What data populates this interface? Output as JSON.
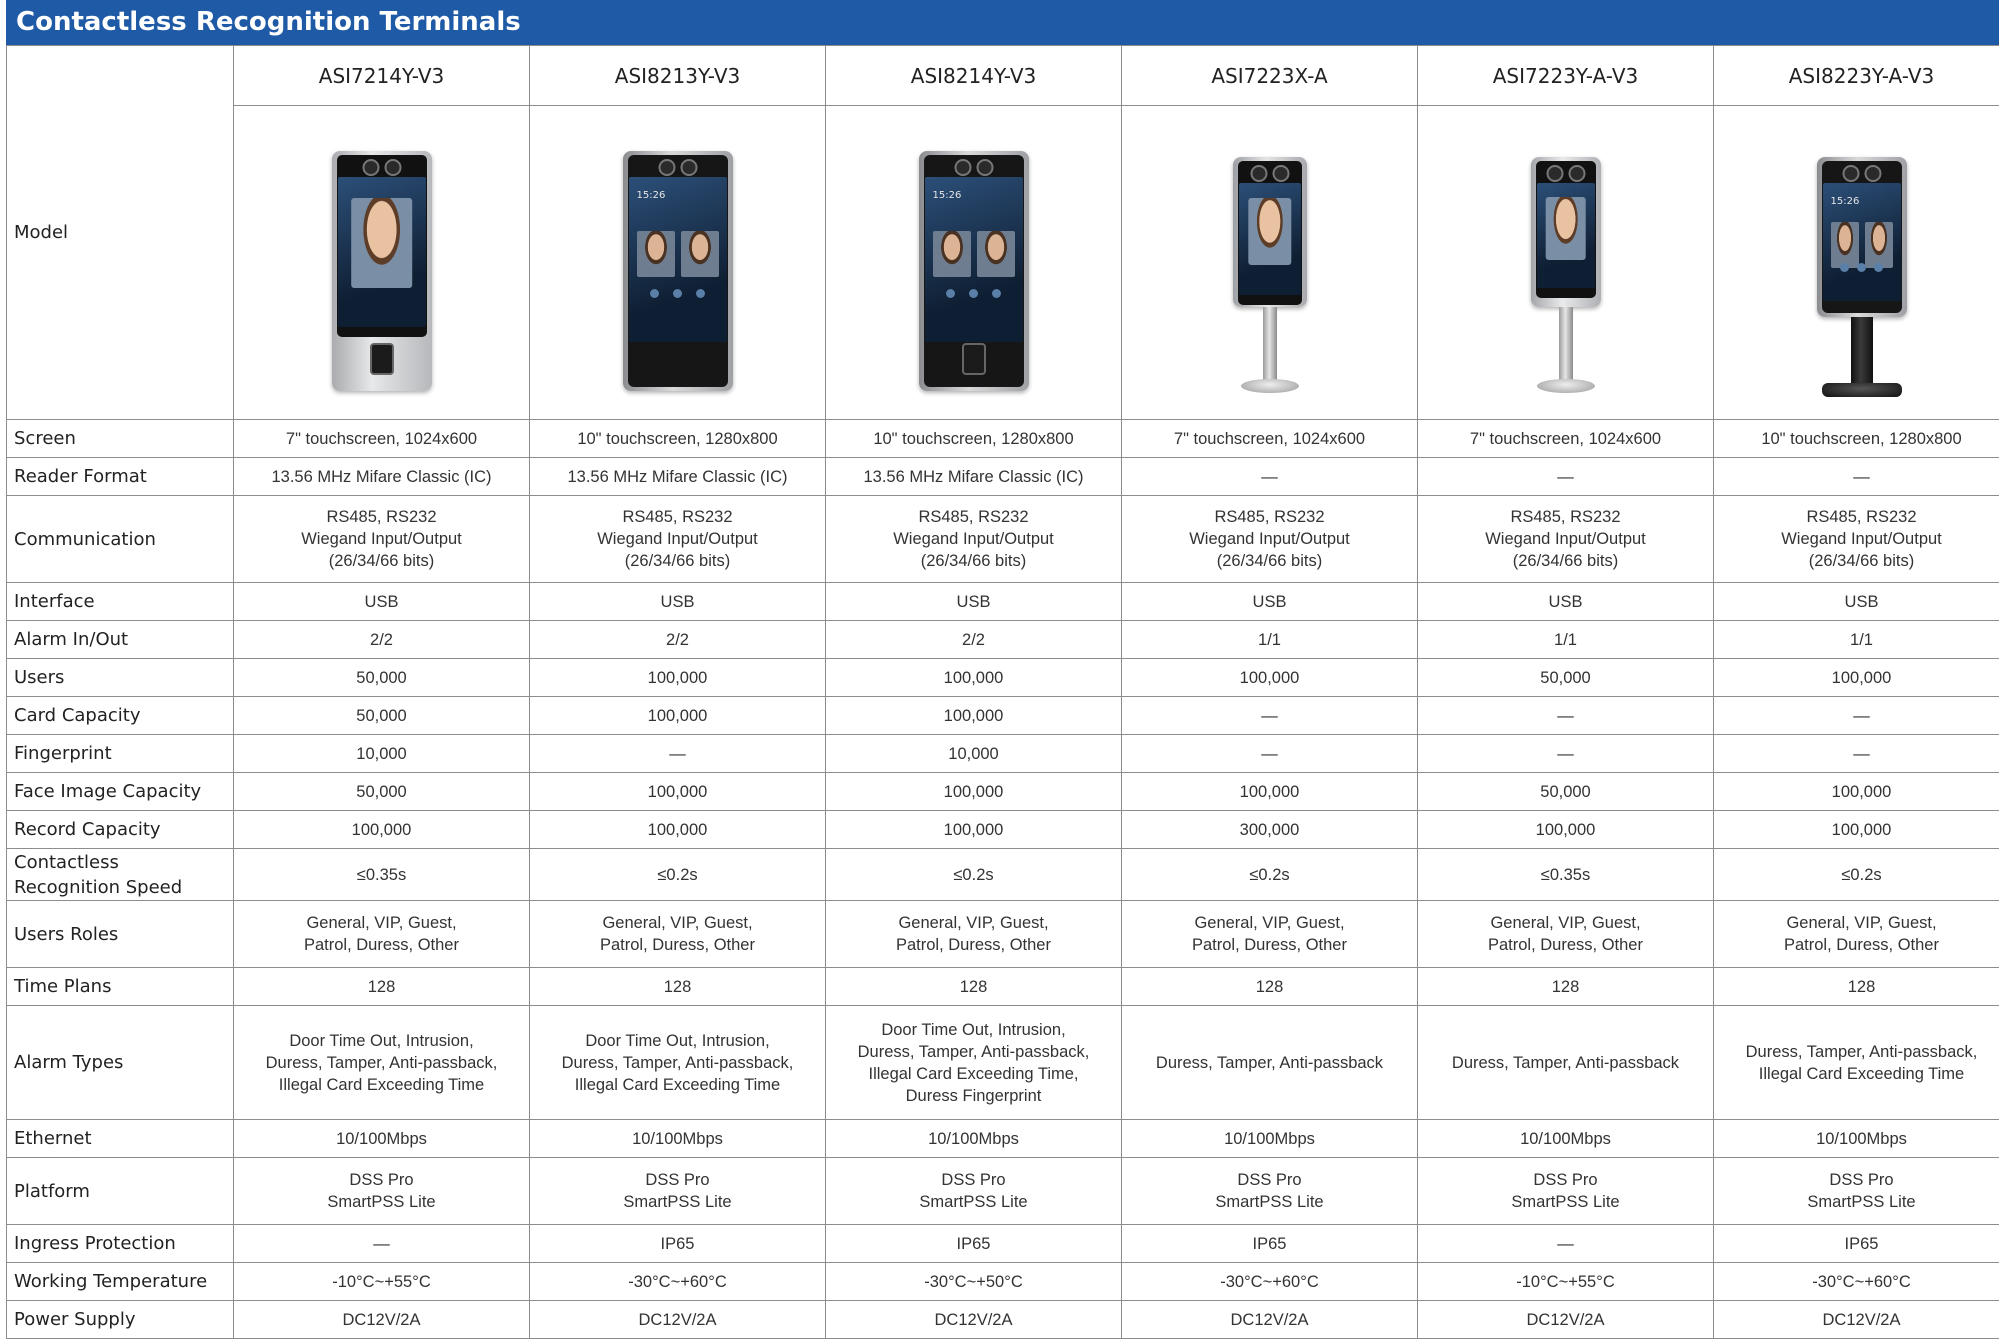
{
  "title": "Contactless Recognition Terminals",
  "model_label": "Model",
  "models": [
    {
      "name": "ASI7214Y-V3",
      "image": "face-terminal-fingerprint-silver"
    },
    {
      "name": "ASI8213Y-V3",
      "image": "face-terminal-black"
    },
    {
      "name": "ASI8214Y-V3",
      "image": "face-terminal-black-fingerprint"
    },
    {
      "name": "ASI7223X-A",
      "image": "face-terminal-on-stand"
    },
    {
      "name": "ASI7223Y-A-V3",
      "image": "face-terminal-silver-on-stand"
    },
    {
      "name": "ASI8223Y-A-V3",
      "image": "face-terminal-black-on-stand"
    }
  ],
  "rows": [
    {
      "label": "Screen",
      "values": [
        "7\" touchscreen, 1024x600",
        "10\" touchscreen, 1280x800",
        "10\" touchscreen, 1280x800",
        "7\" touchscreen, 1024x600",
        "7\" touchscreen, 1024x600",
        "10\" touchscreen, 1280x800"
      ]
    },
    {
      "label": "Reader Format",
      "values": [
        "13.56 MHz Mifare Classic (IC)",
        "13.56 MHz Mifare Classic (IC)",
        "13.56 MHz Mifare Classic (IC)",
        "—",
        "—",
        "—"
      ]
    },
    {
      "label": "Communication",
      "values": [
        "RS485, RS232\nWiegand Input/Output\n(26/34/66 bits)",
        "RS485, RS232\nWiegand Input/Output\n(26/34/66 bits)",
        "RS485, RS232\nWiegand Input/Output\n(26/34/66 bits)",
        "RS485, RS232\nWiegand Input/Output\n(26/34/66 bits)",
        "RS485, RS232\nWiegand Input/Output\n(26/34/66 bits)",
        "RS485, RS232\nWiegand Input/Output\n(26/34/66 bits)"
      ]
    },
    {
      "label": "Interface",
      "values": [
        "USB",
        "USB",
        "USB",
        "USB",
        "USB",
        "USB"
      ]
    },
    {
      "label": "Alarm In/Out",
      "values": [
        "2/2",
        "2/2",
        "2/2",
        "1/1",
        "1/1",
        "1/1"
      ]
    },
    {
      "label": "Users",
      "values": [
        "50,000",
        "100,000",
        "100,000",
        "100,000",
        "50,000",
        "100,000"
      ]
    },
    {
      "label": "Card Capacity",
      "values": [
        "50,000",
        "100,000",
        "100,000",
        "—",
        "—",
        "—"
      ]
    },
    {
      "label": "Fingerprint",
      "values": [
        "10,000",
        "—",
        "10,000",
        "—",
        "—",
        "—"
      ]
    },
    {
      "label": "Face Image Capacity",
      "values": [
        "50,000",
        "100,000",
        "100,000",
        "100,000",
        "50,000",
        "100,000"
      ]
    },
    {
      "label": "Record Capacity",
      "values": [
        "100,000",
        "100,000",
        "100,000",
        "300,000",
        "100,000",
        "100,000"
      ]
    },
    {
      "label": "Contactless Recognition Speed",
      "values": [
        "≤0.35s",
        "≤0.2s",
        "≤0.2s",
        "≤0.2s",
        "≤0.35s",
        "≤0.2s"
      ]
    },
    {
      "label": "Users Roles",
      "values": [
        "General, VIP, Guest,\nPatrol, Duress, Other",
        "General, VIP, Guest,\nPatrol, Duress, Other",
        "General, VIP, Guest,\nPatrol, Duress, Other",
        "General, VIP, Guest,\nPatrol, Duress, Other",
        "General, VIP, Guest,\nPatrol, Duress, Other",
        "General, VIP, Guest,\nPatrol, Duress, Other"
      ]
    },
    {
      "label": "Time Plans",
      "values": [
        "128",
        "128",
        "128",
        "128",
        "128",
        "128"
      ]
    },
    {
      "label": "Alarm Types",
      "values": [
        "Door Time Out, Intrusion,\nDuress, Tamper, Anti-passback,\nIllegal Card Exceeding Time",
        "Door Time Out, Intrusion,\nDuress, Tamper, Anti-passback,\nIllegal Card Exceeding Time",
        "Door Time Out, Intrusion,\nDuress, Tamper, Anti-passback,\nIllegal Card Exceeding Time,\nDuress Fingerprint",
        "Duress, Tamper, Anti-passback",
        "Duress, Tamper, Anti-passback",
        "Duress, Tamper, Anti-passback,\nIllegal Card Exceeding Time"
      ]
    },
    {
      "label": "Ethernet",
      "values": [
        "10/100Mbps",
        "10/100Mbps",
        "10/100Mbps",
        "10/100Mbps",
        "10/100Mbps",
        "10/100Mbps"
      ]
    },
    {
      "label": "Platform",
      "values": [
        "DSS Pro\nSmartPSS Lite",
        "DSS Pro\nSmartPSS Lite",
        "DSS Pro\nSmartPSS Lite",
        "DSS Pro\nSmartPSS Lite",
        "DSS Pro\nSmartPSS Lite",
        "DSS Pro\nSmartPSS Lite"
      ]
    },
    {
      "label": "Ingress Protection",
      "values": [
        "—",
        "IP65",
        "IP65",
        "IP65",
        "—",
        "IP65"
      ]
    },
    {
      "label": "Working Temperature",
      "values": [
        "-10°C~+55°C",
        "-30°C~+60°C",
        "-30°C~+50°C",
        "-30°C~+60°C",
        "-10°C~+55°C",
        "-30°C~+60°C"
      ]
    },
    {
      "label": "Power Supply",
      "values": [
        "DC12V/2A",
        "DC12V/2A",
        "DC12V/2A",
        "DC12V/2A",
        "DC12V/2A",
        "DC12V/2A"
      ]
    }
  ],
  "screen_clock": "15:26",
  "colors": {
    "header_bg": "#1f5aa6",
    "header_text": "#ffffff",
    "border": "#8d8d8d"
  }
}
